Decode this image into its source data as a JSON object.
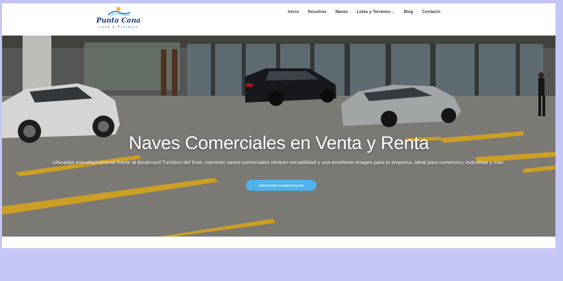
{
  "brand": {
    "name": "Punta Cana",
    "tagline": "Land & Projects"
  },
  "nav": {
    "items": [
      {
        "label": "Inicio"
      },
      {
        "label": "Nosotros"
      },
      {
        "label": "Naves"
      },
      {
        "label": "Lotes y Terrenos",
        "has_dropdown": true
      },
      {
        "label": "Blog"
      },
      {
        "label": "Contacto"
      }
    ]
  },
  "hero": {
    "title": "Naves Comerciales en Venta y Renta",
    "description": "Ubicadas estratégicamente frente al Boulevard Turístico del Este, nuestras naves comerciales ofrecen versatilidad y una excelente imagen para tu empresa. Ideal para comercios, industrias y más.",
    "cta_label": "VER NAVES COMERCIALES"
  },
  "colors": {
    "accent": "#4fb3ec",
    "page_background": "#c4c6f5",
    "parking_lines": "#e8b52a"
  }
}
